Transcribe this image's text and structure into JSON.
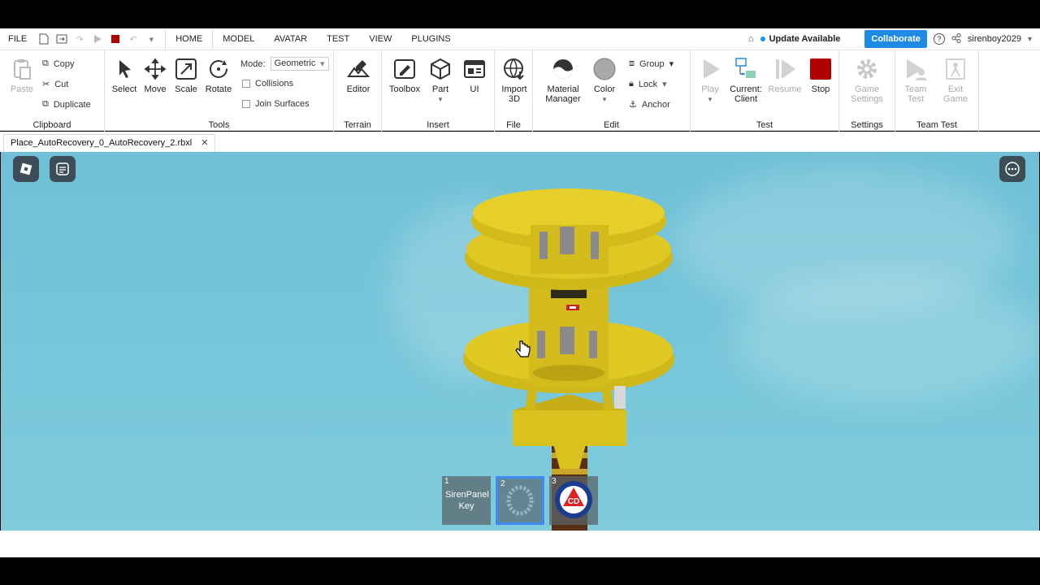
{
  "menu": {
    "file": "FILE",
    "tabs": [
      "HOME",
      "MODEL",
      "AVATAR",
      "TEST",
      "VIEW",
      "PLUGINS"
    ],
    "update": "Update Available",
    "collaborate": "Collaborate",
    "username": "sirenboy2029"
  },
  "ribbon": {
    "clipboard": {
      "label": "Clipboard",
      "paste": "Paste",
      "copy": "Copy",
      "cut": "Cut",
      "duplicate": "Duplicate"
    },
    "tools": {
      "label": "Tools",
      "select": "Select",
      "move": "Move",
      "scale": "Scale",
      "rotate": "Rotate",
      "mode_label": "Mode:",
      "mode_value": "Geometric",
      "collisions": "Collisions",
      "join_surfaces": "Join Surfaces"
    },
    "terrain": {
      "label": "Terrain",
      "editor": "Editor"
    },
    "insert": {
      "label": "Insert",
      "toolbox": "Toolbox",
      "part": "Part",
      "ui": "UI"
    },
    "file": {
      "label": "File",
      "import3d": "Import 3D"
    },
    "edit": {
      "label": "Edit",
      "material_manager": "Material Manager",
      "color": "Color",
      "group": "Group",
      "lock": "Lock",
      "anchor": "Anchor"
    },
    "test": {
      "label": "Test",
      "play": "Play",
      "current_client": "Current: Client",
      "resume": "Resume",
      "stop": "Stop"
    },
    "settings": {
      "label": "Settings",
      "game_settings": "Game Settings"
    },
    "team_test": {
      "label": "Team Test",
      "team_test": "Team Test",
      "exit_game": "Exit Game"
    }
  },
  "document_tab": "Place_AutoRecovery_0_AutoRecovery_2.rbxl",
  "hotbar": [
    {
      "num": "1",
      "label": "SirenPanel Key"
    },
    {
      "num": "2",
      "label": ""
    },
    {
      "num": "3",
      "label": ""
    }
  ],
  "colors": {
    "accent": "#1e8ae6",
    "stop": "#b00000",
    "siren": "#d9c21e",
    "sky": "#74c4d8"
  }
}
